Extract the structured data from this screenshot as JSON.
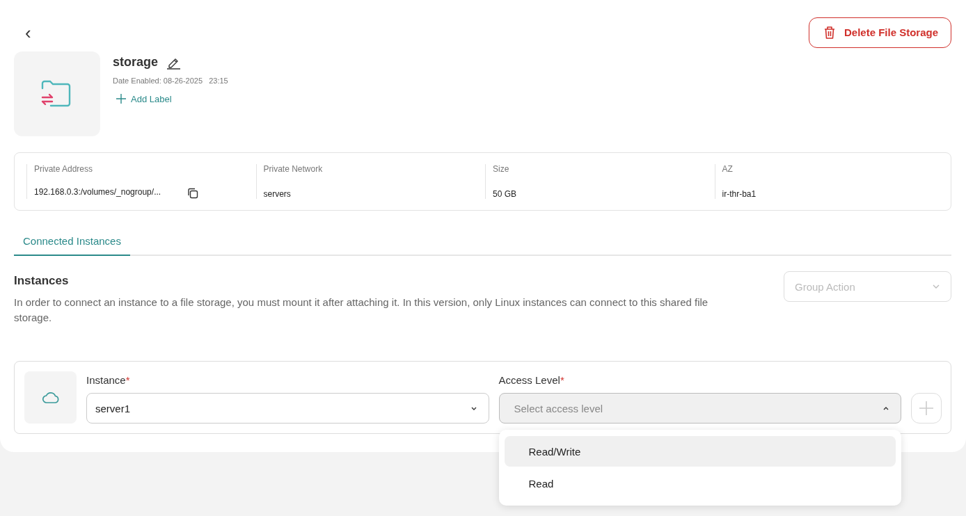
{
  "header": {
    "back": "‹",
    "delete_button": "Delete File Storage"
  },
  "resource": {
    "name": "storage",
    "date_enabled": "Date Enabled: 08-26-2025   23:15",
    "add_label": "Add Label"
  },
  "details": [
    {
      "label": "Private Address",
      "value": "192.168.0.3:/volumes/_nogroup/...",
      "copyable": true
    },
    {
      "label": "Private Network",
      "value": "servers",
      "copyable": false
    },
    {
      "label": "Size",
      "value": "50 GB",
      "copyable": false
    },
    {
      "label": "AZ",
      "value": "ir-thr-ba1",
      "copyable": false
    }
  ],
  "tabs": [
    {
      "label": "Connected Instances",
      "selected": true
    }
  ],
  "instances": {
    "title": "Instances",
    "description": "In order to connect an instance to a file storage, you must mount it after attaching it. In this version, only Linux instances can connect to this shared file storage.",
    "group_action": {
      "placeholder": "Group Action"
    },
    "fields": [
      {
        "label": "Instance",
        "required_mark": "*",
        "value": "server1",
        "expanded": false
      },
      {
        "label": "Access Level",
        "required_mark": "*",
        "placeholder": "Select access level",
        "expanded": true,
        "options": [
          {
            "label": "Read/Write",
            "selected": true
          },
          {
            "label": "Read",
            "selected": false
          }
        ]
      }
    ]
  }
}
